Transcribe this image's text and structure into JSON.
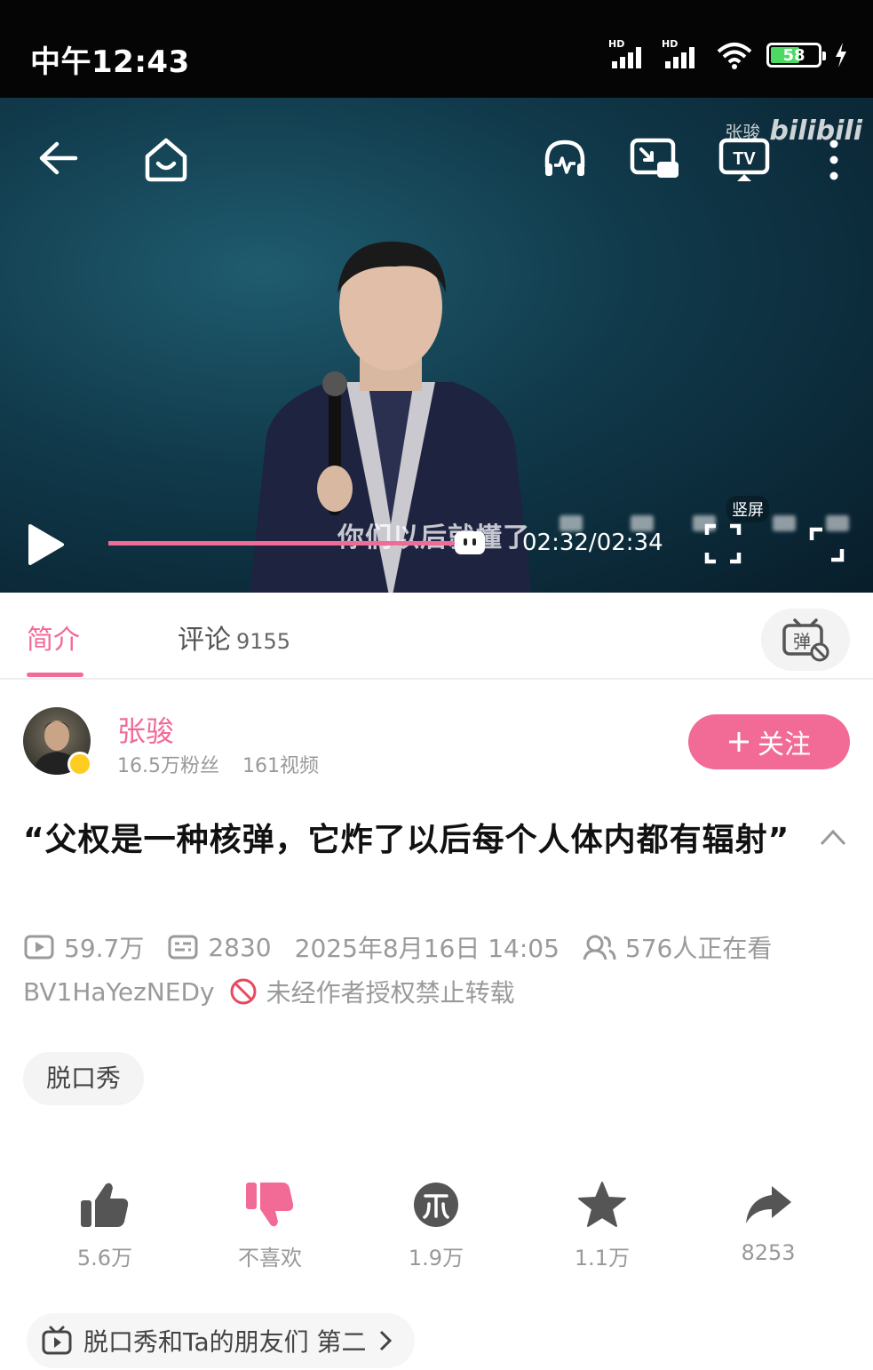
{
  "status_bar": {
    "time": "中午12:43",
    "signal_label": "HD",
    "battery": "58"
  },
  "player": {
    "watermark_name": "张骏",
    "watermark_logo": "bilibili",
    "subtitle": "你们以后就懂了",
    "time": "02:32/02:34",
    "progress": 0.987,
    "vertical_label": "竖屏",
    "accent": "#f26b96"
  },
  "tabs": {
    "intro": "简介",
    "comments": "评论",
    "comments_count": "9155",
    "danmaku_label": "弹"
  },
  "uploader": {
    "name": "张骏",
    "fans": "16.5万粉丝",
    "videos": "161视频",
    "follow_label": "关注"
  },
  "video": {
    "title": "“父权是一种核弹，它炸了以后每个人体内都有辐射”",
    "views": "59.7万",
    "danmaku_count": "2830",
    "date": "2025年8月16日 14:05",
    "watching": "576人正在看",
    "bvid": "BV1HaYezNEDy",
    "copyright": "未经作者授权禁止转载",
    "tag": "脱口秀"
  },
  "actions": {
    "like": "5.6万",
    "dislike": "不喜欢",
    "coin": "1.9万",
    "favorite": "1.1万",
    "share": "8253"
  },
  "collection": {
    "label": "脱口秀和Ta的朋友们 第二"
  }
}
